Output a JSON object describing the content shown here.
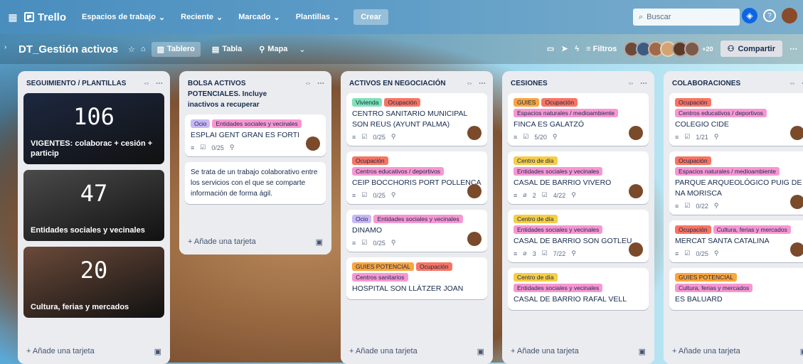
{
  "topbar": {
    "apps_icon": "grid-icon",
    "app_name": "Trello",
    "nav": [
      "Espacios de trabajo",
      "Reciente",
      "Marcado",
      "Plantillas"
    ],
    "create": "Crear",
    "search_placeholder": "Buscar"
  },
  "board": {
    "title": "DT_Gestión activos",
    "views": [
      "Tablero",
      "Tabla",
      "Mapa"
    ],
    "filters": "Filtros",
    "member_extra": "+20",
    "share": "Compartir"
  },
  "add_card": "Añade una tarjeta",
  "lists": [
    {
      "title": "SEGUIMIENTO / PLANTILLAS",
      "covers": [
        {
          "number": "106",
          "text": "VIGENTES: colaborac + cesión + particip",
          "color": "#1d2840"
        },
        {
          "number": "47",
          "text": "Entidades sociales y vecinales",
          "color": "#4a4a4a"
        },
        {
          "number": "20",
          "text": "Cultura, ferias y mercados",
          "color": "#6b4a3a"
        }
      ]
    },
    {
      "title": "BOLSA ACTIVOS POTENCIALES. Incluye inactivos a recuperar",
      "cards": [
        {
          "labels": [
            {
              "t": "Ocio",
              "c": "#c9b8f5"
            },
            {
              "t": "Entidades sociales y vecinales",
              "c": "#f797d2"
            }
          ],
          "title": "ESPLAI GENT GRAN ES FORTI",
          "meta": "0/25"
        },
        {
          "desc": "Se trata de un trabajo colaborativo entre los servicios con el que se comparte información de forma ágil."
        }
      ]
    },
    {
      "title": "ACTIVOS EN NEGOCIACIÓN",
      "cards": [
        {
          "labels": [
            {
              "t": "Vivienda",
              "c": "#7ee2b8"
            },
            {
              "t": "Ocupación",
              "c": "#f87462"
            }
          ],
          "title": "CENTRO SANITARIO MUNICIPAL SON REUS (AYUNT PALMA)",
          "meta": "0/25"
        },
        {
          "labels": [
            {
              "t": "Ocupación",
              "c": "#f87462"
            },
            {
              "t": "Centros educativos / deportivos",
              "c": "#f797d2"
            }
          ],
          "title": "CEIP BOCCHORIS PORT POLLENÇA",
          "meta": "0/25"
        },
        {
          "labels": [
            {
              "t": "Ocio",
              "c": "#c9b8f5"
            },
            {
              "t": "Entidades sociales y vecinales",
              "c": "#f797d2"
            }
          ],
          "title": "DINAMO",
          "meta": "0/25"
        },
        {
          "labels": [
            {
              "t": "GUIES POTENCIAL",
              "c": "#faa53d"
            },
            {
              "t": "Ocupación",
              "c": "#f87462"
            },
            {
              "t": "Centros sanitarios",
              "c": "#f797d2"
            }
          ],
          "title": "HOSPITAL SON LLÀTZER JOAN",
          "meta": ""
        }
      ]
    },
    {
      "title": "CESIONES",
      "cards": [
        {
          "labels": [
            {
              "t": "GUIES",
              "c": "#faa53d"
            },
            {
              "t": "Ocupación",
              "c": "#f87462"
            },
            {
              "t": "Espacios naturales / medioambiente",
              "c": "#f797d2"
            }
          ],
          "title": "FINCA ES GALATZÓ",
          "meta": "5/20"
        },
        {
          "labels": [
            {
              "t": "Centro de día",
              "c": "#f5cd47"
            },
            {
              "t": "Entidades sociales y vecinales",
              "c": "#f797d2"
            }
          ],
          "title": "CASAL DE BARRIO VIVERO",
          "meta": "4/22",
          "att": "2"
        },
        {
          "labels": [
            {
              "t": "Centro de día",
              "c": "#f5cd47"
            },
            {
              "t": "Entidades sociales y vecinales",
              "c": "#f797d2"
            }
          ],
          "title": "CASAL DE BARRIO SON GOTLEU",
          "meta": "7/22",
          "att": "3"
        },
        {
          "labels": [
            {
              "t": "Centro de día",
              "c": "#f5cd47"
            },
            {
              "t": "Entidades sociales y vecinales",
              "c": "#f797d2"
            }
          ],
          "title": "CASAL DE BARRIO RAFAL VELL",
          "meta": ""
        }
      ]
    },
    {
      "title": "COLABORACIONES",
      "cards": [
        {
          "labels": [
            {
              "t": "Ocupación",
              "c": "#f87462"
            },
            {
              "t": "Centros educativos / deportivos",
              "c": "#f797d2"
            }
          ],
          "title": "Colegio CIDE",
          "meta": "1/21"
        },
        {
          "labels": [
            {
              "t": "Ocupación",
              "c": "#f87462"
            },
            {
              "t": "Espacios naturales / medioambiente",
              "c": "#f797d2"
            }
          ],
          "title": "PARQUE ARQUEOLÓGICO PUIG DE NA MORISCA",
          "meta": "0/22"
        },
        {
          "labels": [
            {
              "t": "Ocupación",
              "c": "#f87462"
            },
            {
              "t": "Cultura, ferias y mercados",
              "c": "#f797d2"
            }
          ],
          "title": "MERCAT SANTA CATALINA",
          "meta": "0/25"
        },
        {
          "labels": [
            {
              "t": "GUIES POTENCIAL",
              "c": "#faa53d"
            },
            {
              "t": "Cultura, ferias y mercados",
              "c": "#f797d2"
            }
          ],
          "title": "ES BALUARD",
          "meta": ""
        }
      ]
    }
  ]
}
